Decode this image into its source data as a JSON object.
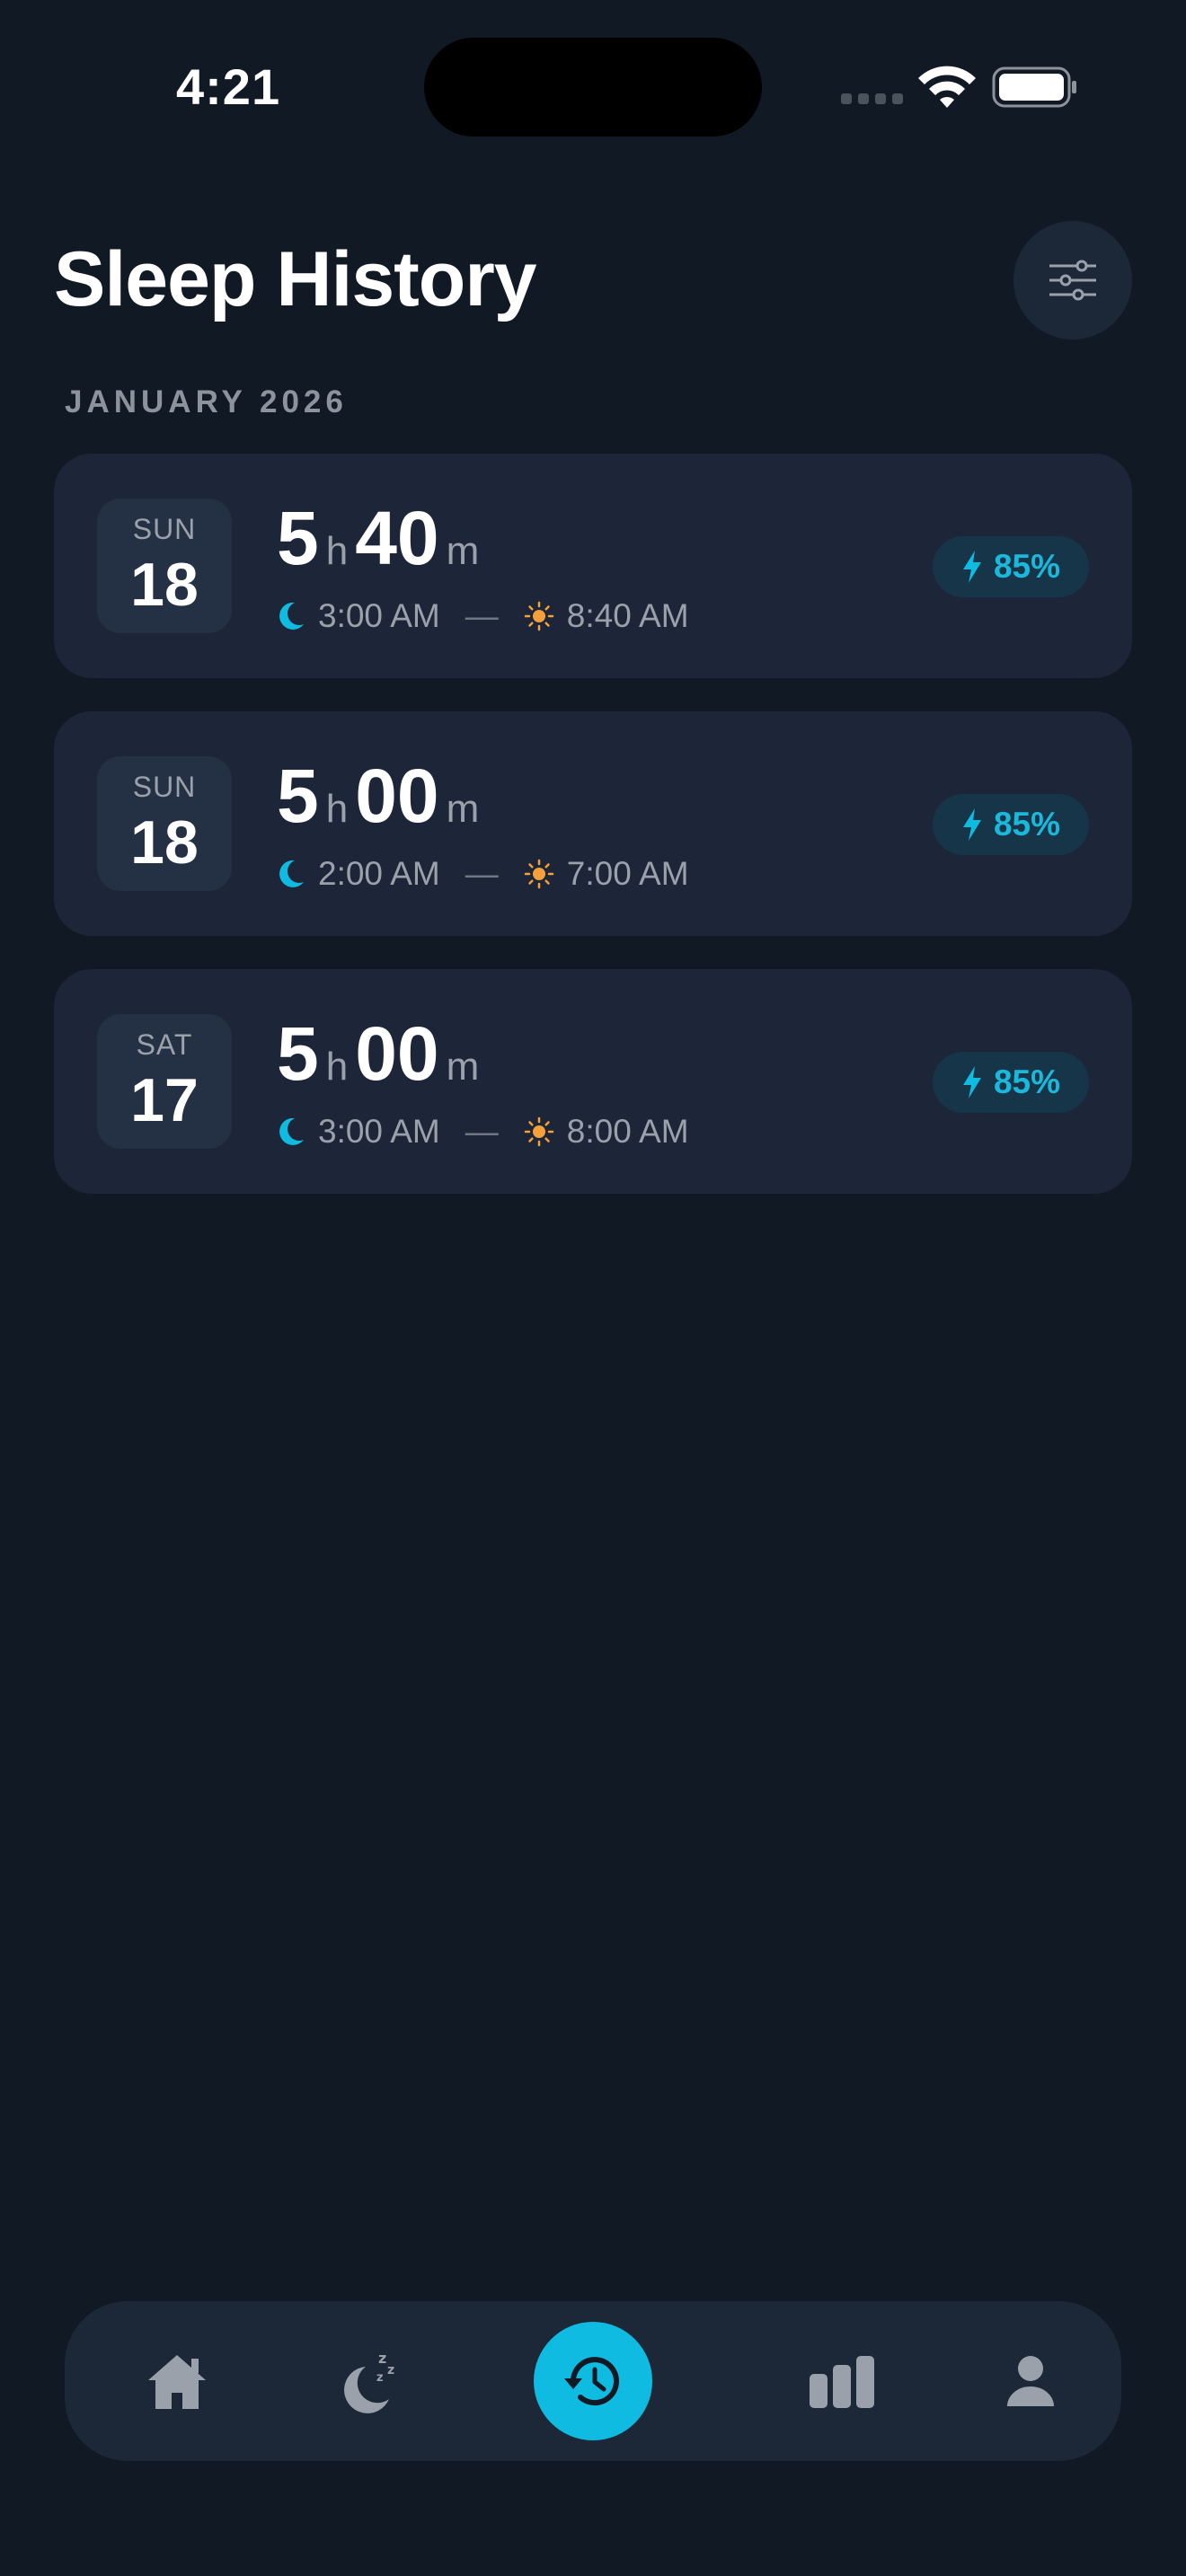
{
  "status_bar": {
    "time": "4:21"
  },
  "header": {
    "title": "Sleep History"
  },
  "section": {
    "month": "JANUARY 2026"
  },
  "entries": [
    {
      "dow": "SUN",
      "day": "18",
      "hours": "5",
      "minutes": "40",
      "hour_unit": "h",
      "minute_unit": "m",
      "bedtime": "3:00 AM",
      "separator": "—",
      "wake": "8:40 AM",
      "quality": "85%"
    },
    {
      "dow": "SUN",
      "day": "18",
      "hours": "5",
      "minutes": "00",
      "hour_unit": "h",
      "minute_unit": "m",
      "bedtime": "2:00 AM",
      "separator": "—",
      "wake": "7:00 AM",
      "quality": "85%"
    },
    {
      "dow": "SAT",
      "day": "17",
      "hours": "5",
      "minutes": "00",
      "hour_unit": "h",
      "minute_unit": "m",
      "bedtime": "3:00 AM",
      "separator": "—",
      "wake": "8:00 AM",
      "quality": "85%"
    }
  ],
  "tab_bar": {
    "tabs": [
      {
        "icon": "home-icon",
        "active": false
      },
      {
        "icon": "sleep-moon-icon",
        "active": false
      },
      {
        "icon": "history-icon",
        "active": true
      },
      {
        "icon": "bar-chart-icon",
        "active": false
      },
      {
        "icon": "profile-icon",
        "active": false
      }
    ]
  },
  "colors": {
    "background": "#111924",
    "card": "#1c2638",
    "accent": "#0fbbe0",
    "sun": "#f5a03a",
    "muted_text": "#9aa1aa"
  }
}
